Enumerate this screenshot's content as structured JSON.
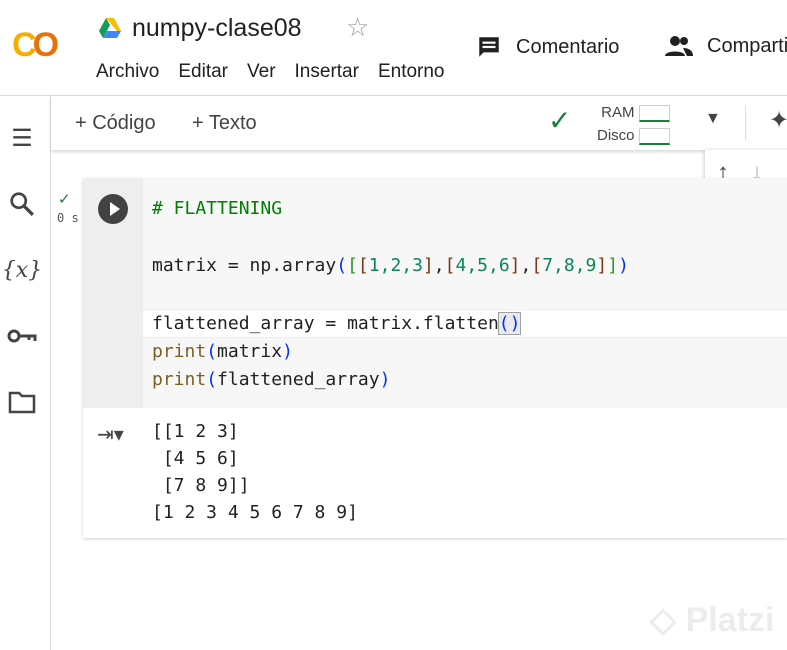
{
  "header": {
    "logo": "CO",
    "title": "numpy-clase08",
    "menu": [
      "Archivo",
      "Editar",
      "Ver",
      "Insertar",
      "Entorno"
    ],
    "comment_label": "Comentario",
    "share_label": "Compartir"
  },
  "toolbar": {
    "add_code": "+ Código",
    "add_text": "+ Texto",
    "ram_label": "RAM",
    "disk_label": "Disco"
  },
  "cell": {
    "exec_time": "0 s",
    "code": [
      [
        {
          "t": "# FLATTENING",
          "c": "comment"
        }
      ],
      [],
      [
        {
          "t": "matrix = np.array",
          "c": "def"
        },
        {
          "t": "(",
          "c": "b1"
        },
        {
          "t": "[",
          "c": "b2"
        },
        {
          "t": "[",
          "c": "b3"
        },
        {
          "t": "1,2,3",
          "c": "num"
        },
        {
          "t": "]",
          "c": "b3"
        },
        {
          "t": ",",
          "c": "def"
        },
        {
          "t": "[",
          "c": "b3"
        },
        {
          "t": "4,5,6",
          "c": "num"
        },
        {
          "t": "]",
          "c": "b3"
        },
        {
          "t": ",",
          "c": "def"
        },
        {
          "t": "[",
          "c": "b3"
        },
        {
          "t": "7,8,9",
          "c": "num"
        },
        {
          "t": "]",
          "c": "b3"
        },
        {
          "t": "]",
          "c": "b2"
        },
        {
          "t": ")",
          "c": "b1"
        }
      ],
      [],
      [
        {
          "t": "flattened_array = matrix.flatten",
          "c": "def"
        },
        {
          "t": "()",
          "c": "b1 c-sel"
        }
      ],
      [
        {
          "t": "print",
          "c": "fn"
        },
        {
          "t": "(",
          "c": "b1"
        },
        {
          "t": "matrix",
          "c": "def"
        },
        {
          "t": ")",
          "c": "b1"
        }
      ],
      [
        {
          "t": "print",
          "c": "fn"
        },
        {
          "t": "(",
          "c": "b1"
        },
        {
          "t": "flattened_array",
          "c": "def"
        },
        {
          "t": ")",
          "c": "b1"
        }
      ]
    ],
    "output": "[[1 2 3]\n [4 5 6]\n [7 8 9]]\n[1 2 3 4 5 6 7 8 9]"
  },
  "watermark": "Platzi"
}
